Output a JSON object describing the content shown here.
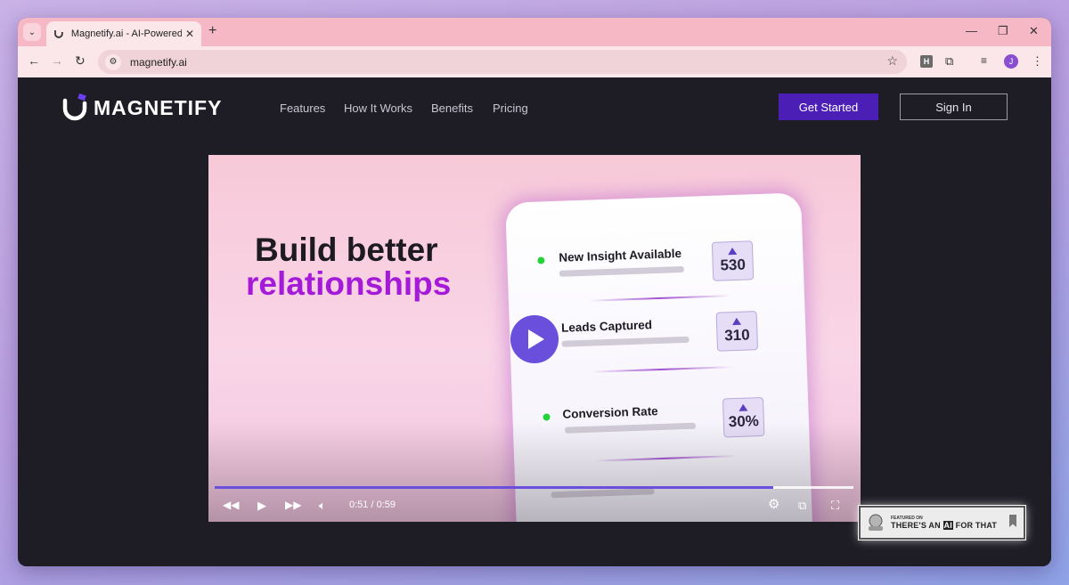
{
  "browser": {
    "tab_title": "Magnetify.ai - AI-Powered Lead",
    "new_tab_label": "+",
    "url": "magnetify.ai",
    "profile_initial": "J",
    "extension_letter": "H"
  },
  "site": {
    "logo_text": "MAGNETIFY",
    "nav": [
      "Features",
      "How It Works",
      "Benefits",
      "Pricing"
    ],
    "get_started": "Get Started",
    "sign_in": "Sign In"
  },
  "video": {
    "headline_line1": "Build better",
    "headline_line2": "relationships",
    "rows": [
      {
        "title": "New Insight Available",
        "value": "530"
      },
      {
        "title": "Leads Captured",
        "value": "310"
      },
      {
        "title": "Conversion Rate",
        "value": "30%"
      }
    ],
    "time": "0:51 / 0:59",
    "progress_fraction": 0.875
  },
  "badge": {
    "small_text": "FEATURED ON",
    "big_pre": "THERE'S AN",
    "big_ai": "AI",
    "big_post": "FOR THAT"
  },
  "colors": {
    "accent": "#4b1fb6",
    "headline_purple": "#a51ad8",
    "play_purple": "#6a4fdc",
    "tab_strip": "#f5b8c4"
  }
}
